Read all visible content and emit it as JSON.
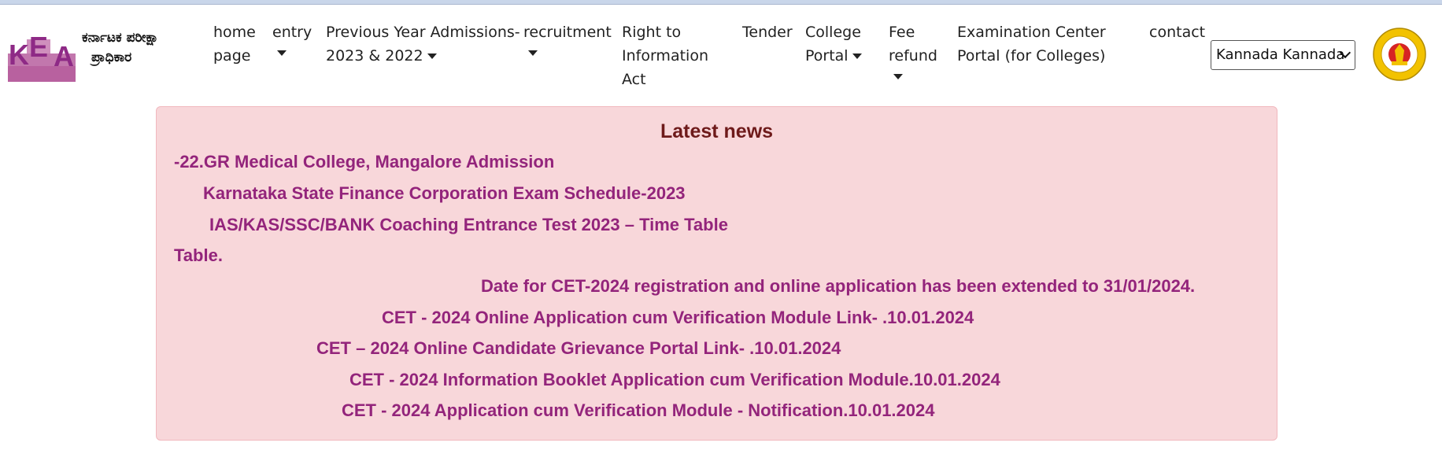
{
  "header": {
    "logo_letters": [
      "K",
      "E",
      "A"
    ],
    "logo_text_line1": "ಕರ್ನಾಟಕ ಪರೀಕ್ಷಾ",
    "logo_text_line2": "ಪ್ರಾಧಿಕಾರ"
  },
  "nav": {
    "home_line1": "home",
    "home_line2": "page",
    "entry": "entry",
    "prev_line1": "Previous Year Admissions-",
    "prev_line2": "2023 & 2022",
    "recruitment": "recruitment",
    "rti_line1": "Right to",
    "rti_line2": "Information",
    "rti_line3": "Act",
    "tender": "Tender",
    "college_line1": "College",
    "college_line2": "Portal",
    "fee_line1": "Fee",
    "fee_line2": "refund",
    "exam_line1": "Examination Center",
    "exam_line2": "Portal (for Colleges)",
    "contact": "contact"
  },
  "language_select": {
    "selected": "Kannada Kannada"
  },
  "news": {
    "title": "Latest news",
    "items": [
      "-22.GR Medical College, Mangalore Admission",
      "Karnataka State Finance Corporation Exam Schedule-2023",
      "IAS/KAS/SSC/BANK Coaching Entrance Test 2023 – Time Table",
      "Table.",
      "Date for CET-2024 registration and online application has been extended to 31/01/2024.",
      "CET - 2024 Online Application cum Verification Module Link- .10.01.2024",
      "CET – 2024 Online Candidate Grievance Portal Link- .10.01.2024",
      "CET - 2024 Information Booklet Application cum Verification Module.10.01.2024",
      "CET - 2024 Application cum Verification Module - Notification.10.01.2024"
    ]
  },
  "colors": {
    "news_bg": "#f8d7da",
    "news_link": "#93247b",
    "news_title": "#6e1a1a",
    "logo_purple": "#b0569f"
  }
}
